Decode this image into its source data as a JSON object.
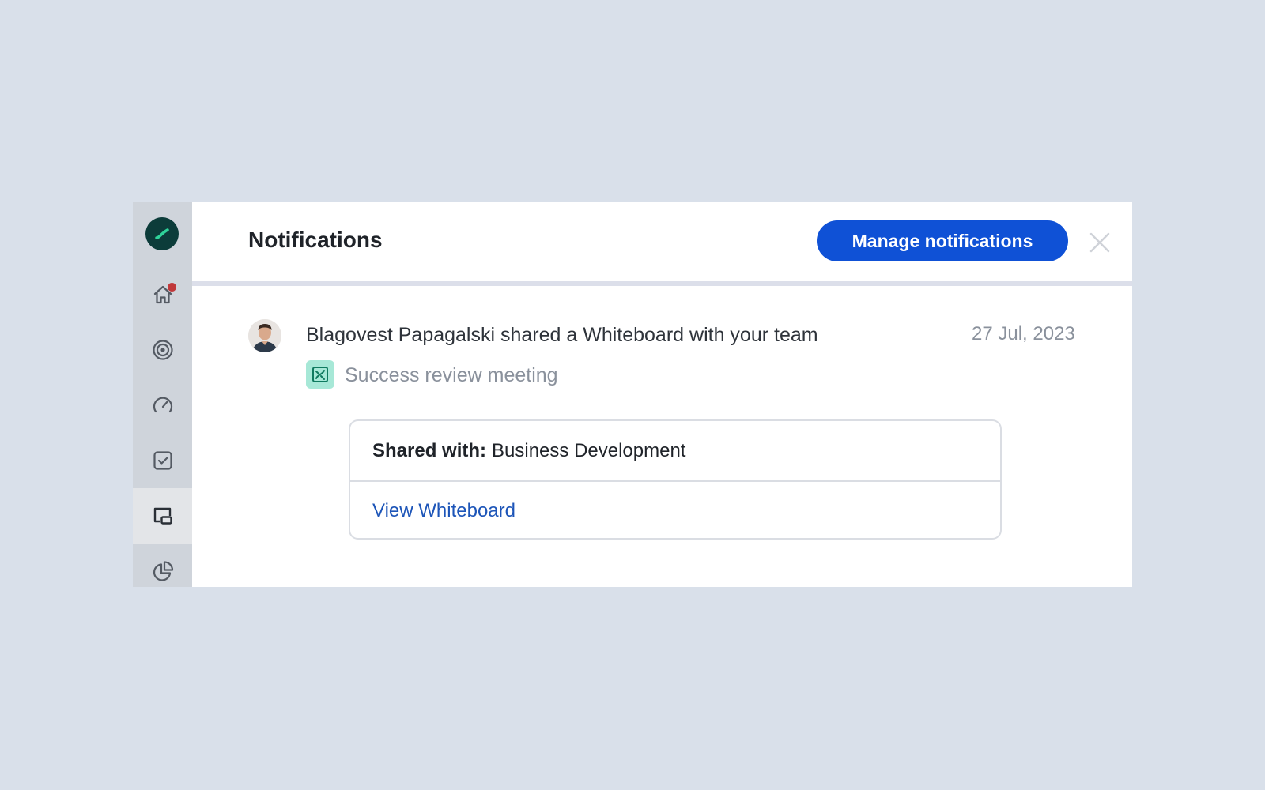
{
  "sidebar": {
    "logo_icon": "whatfix-logo-icon",
    "items": [
      {
        "icon": "home-icon",
        "has_notification": true
      },
      {
        "icon": "target-icon"
      },
      {
        "icon": "speedometer-icon"
      },
      {
        "icon": "checkbox-icon"
      },
      {
        "icon": "whiteboard-icon",
        "active": true
      },
      {
        "icon": "pie-chart-icon"
      }
    ]
  },
  "header": {
    "title": "Notifications",
    "manage_button_label": "Manage notifications",
    "close_icon": "close-icon"
  },
  "notification": {
    "avatar_icon": "user-avatar",
    "message": "Blagovest Papagalski shared a Whiteboard with your team",
    "date": "27 Jul, 2023",
    "item_icon": "whiteboard-item-icon",
    "item_name": "Success review meeting",
    "card": {
      "shared_with_label": "Shared with:",
      "shared_with_value": "Business Development",
      "link_label": "View Whiteboard"
    }
  },
  "colors": {
    "page_background": "#d9e0ea",
    "sidebar_background": "#cfd4db",
    "primary_button": "#0f51d6",
    "link": "#1d55b8",
    "notification_dot": "#c0383a",
    "whiteboard_icon_bg": "#a7e8d7"
  }
}
